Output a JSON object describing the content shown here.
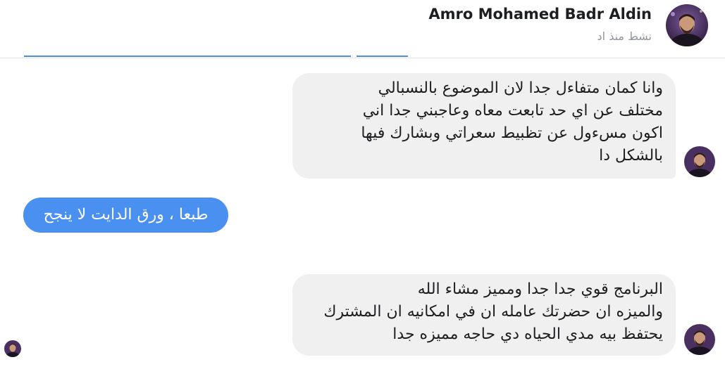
{
  "header": {
    "contact_name": "Amro Mohamed Badr Aldin",
    "status": "نشط منذ اد"
  },
  "messages": [
    {
      "direction": "incoming",
      "lines": [
        "وانا كمان متفاءل جدا لان الموضوع بالنسبالي",
        "مختلف عن اي حد تابعت معاه وعاجبني جدا اني",
        "اكون مسءول عن تظبيط سعراتي وبشارك فيها",
        "بالشكل دا"
      ]
    },
    {
      "direction": "outgoing",
      "text": "طبعا ، ورق الدايت لا ينجح"
    },
    {
      "direction": "incoming",
      "lines": [
        "البرنامج قوي جدا جدا ومميز مشاء الله",
        "والميزه ان حضرتك عامله ان في امكانيه ان المشترك",
        "يحتفظ بيه مدي الحياه دي حاجه مميزه جدا"
      ]
    }
  ],
  "colors": {
    "incoming_bubble": "#f1f0f0",
    "outgoing_bubble": "#4a90f0",
    "accent": "#4a90e2"
  },
  "icons": {
    "contact_avatar": "avatar-photo",
    "seen_indicator": "mini-avatar"
  }
}
